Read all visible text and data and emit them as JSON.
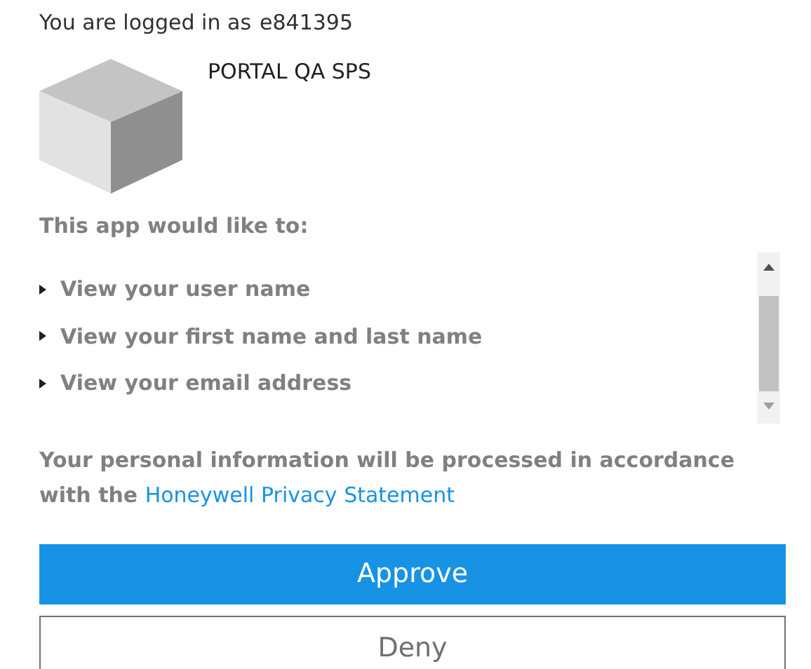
{
  "login": {
    "label": "You are logged in as",
    "user": "e841395"
  },
  "app": {
    "name": "PORTAL QA SPS"
  },
  "permissions": {
    "heading": "This app would like to:",
    "items": [
      "View your user name",
      "View your first name and last name",
      "View your email address"
    ]
  },
  "notice": {
    "text": "Your personal information will be processed in accordance with the",
    "link": "Honeywell Privacy Statement"
  },
  "buttons": [
    {
      "label": "Approve",
      "kind": "primary"
    },
    {
      "label": "Deny",
      "kind": "secondary"
    }
  ]
}
